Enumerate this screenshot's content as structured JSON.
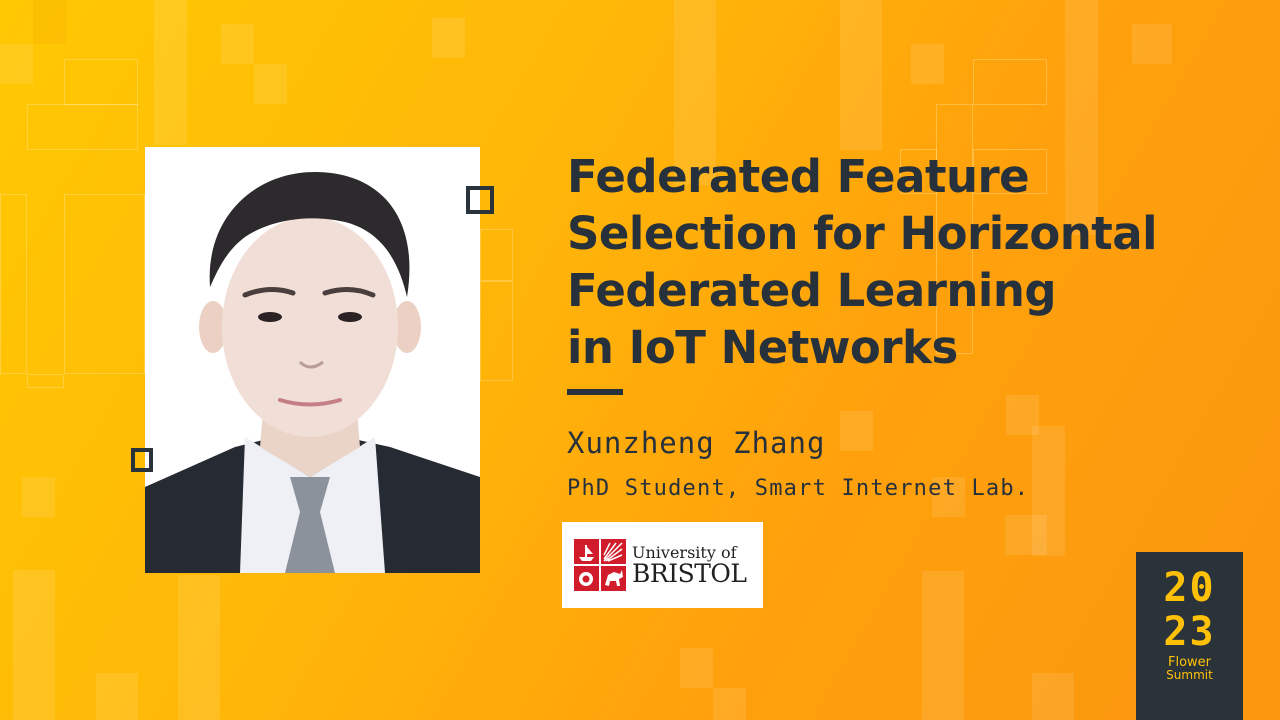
{
  "talk": {
    "title_lines": [
      "Federated Feature",
      "Selection for Horizontal",
      "Federated Learning",
      "in IoT Networks"
    ]
  },
  "speaker": {
    "name": "Xunzheng Zhang",
    "role": "PhD Student, Smart Internet Lab.",
    "photo_alt": "Speaker portrait photo"
  },
  "affiliation": {
    "logo_line1": "University of",
    "logo_line2": "BRISTOL",
    "crest_icon": "university-crest-icon",
    "crest_color": "#d01c2b"
  },
  "event": {
    "year_top": "20",
    "year_bottom": "23",
    "name_line1": "Flower",
    "name_line2": "Summit",
    "accent": "#ffc107",
    "badge_bg": "#2a323a"
  },
  "theme": {
    "background_start": "#ffc803",
    "background_end": "#fb960f",
    "text_color": "#27313b"
  }
}
